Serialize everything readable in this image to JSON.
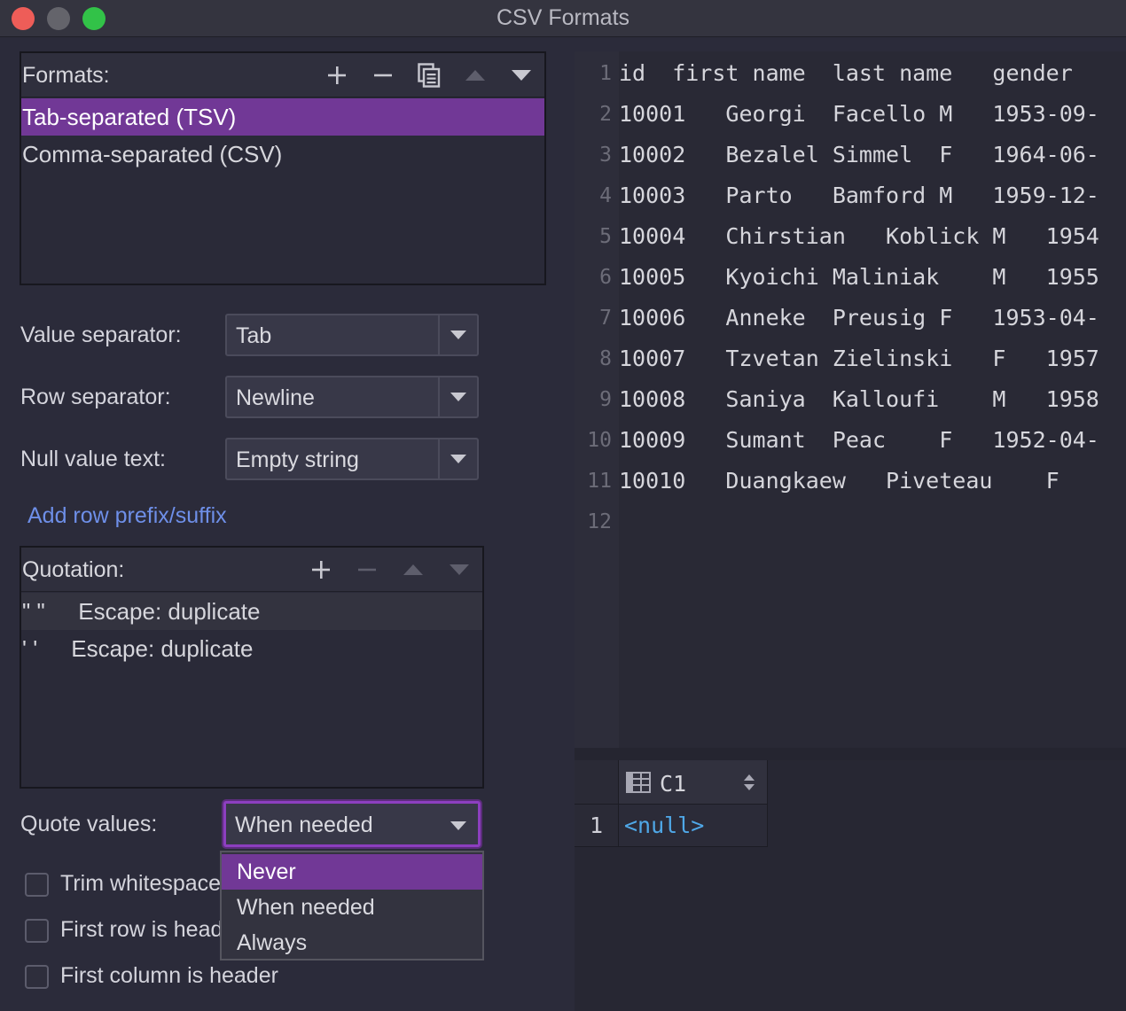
{
  "window": {
    "title": "CSV Formats"
  },
  "formats": {
    "label": "Formats:",
    "items": [
      "Tab-separated (TSV)",
      "Comma-separated (CSV)"
    ],
    "selected_index": 0
  },
  "fields": {
    "value_separator": {
      "label": "Value separator:",
      "value": "Tab"
    },
    "row_separator": {
      "label": "Row separator:",
      "value": "Newline"
    },
    "null_value_text": {
      "label": "Null value text:",
      "value": "Empty string"
    }
  },
  "add_row_link": "Add row prefix/suffix",
  "quotation": {
    "label": "Quotation:",
    "items": [
      {
        "quote": "\"  \"",
        "escape": "Escape: duplicate"
      },
      {
        "quote": "'  '",
        "escape": "Escape: duplicate"
      }
    ]
  },
  "quote_values": {
    "label": "Quote values:",
    "value": "When needed",
    "options": [
      "Never",
      "When needed",
      "Always"
    ],
    "highlighted_index": 0
  },
  "checkboxes": [
    {
      "label": "Trim whitespace",
      "checked": false
    },
    {
      "label": "First row is header",
      "checked": false
    },
    {
      "label": "First column is header",
      "checked": false
    }
  ],
  "preview": {
    "lines": [
      {
        "n": "1",
        "text": "id  first name  last name   gender"
      },
      {
        "n": "2",
        "text": "10001   Georgi  Facello M   1953-09-"
      },
      {
        "n": "3",
        "text": "10002   Bezalel Simmel  F   1964-06-"
      },
      {
        "n": "4",
        "text": "10003   Parto   Bamford M   1959-12-"
      },
      {
        "n": "5",
        "text": "10004   Chirstian   Koblick M   1954"
      },
      {
        "n": "6",
        "text": "10005   Kyoichi Maliniak    M   1955"
      },
      {
        "n": "7",
        "text": "10006   Anneke  Preusig F   1953-04-"
      },
      {
        "n": "8",
        "text": "10007   Tzvetan Zielinski   F   1957"
      },
      {
        "n": "9",
        "text": "10008   Saniya  Kalloufi    M   1958"
      },
      {
        "n": "10",
        "text": "10009   Sumant  Peac    F   1952-04-"
      },
      {
        "n": "11",
        "text": "10010   Duangkaew   Piveteau    F"
      },
      {
        "n": "12",
        "text": ""
      }
    ]
  },
  "result_grid": {
    "column": "C1",
    "row_number": "1",
    "cell_value": "<null>"
  },
  "colors": {
    "accent": "#713896",
    "link": "#6e8fe8",
    "null_text": "#4fa8e8"
  }
}
